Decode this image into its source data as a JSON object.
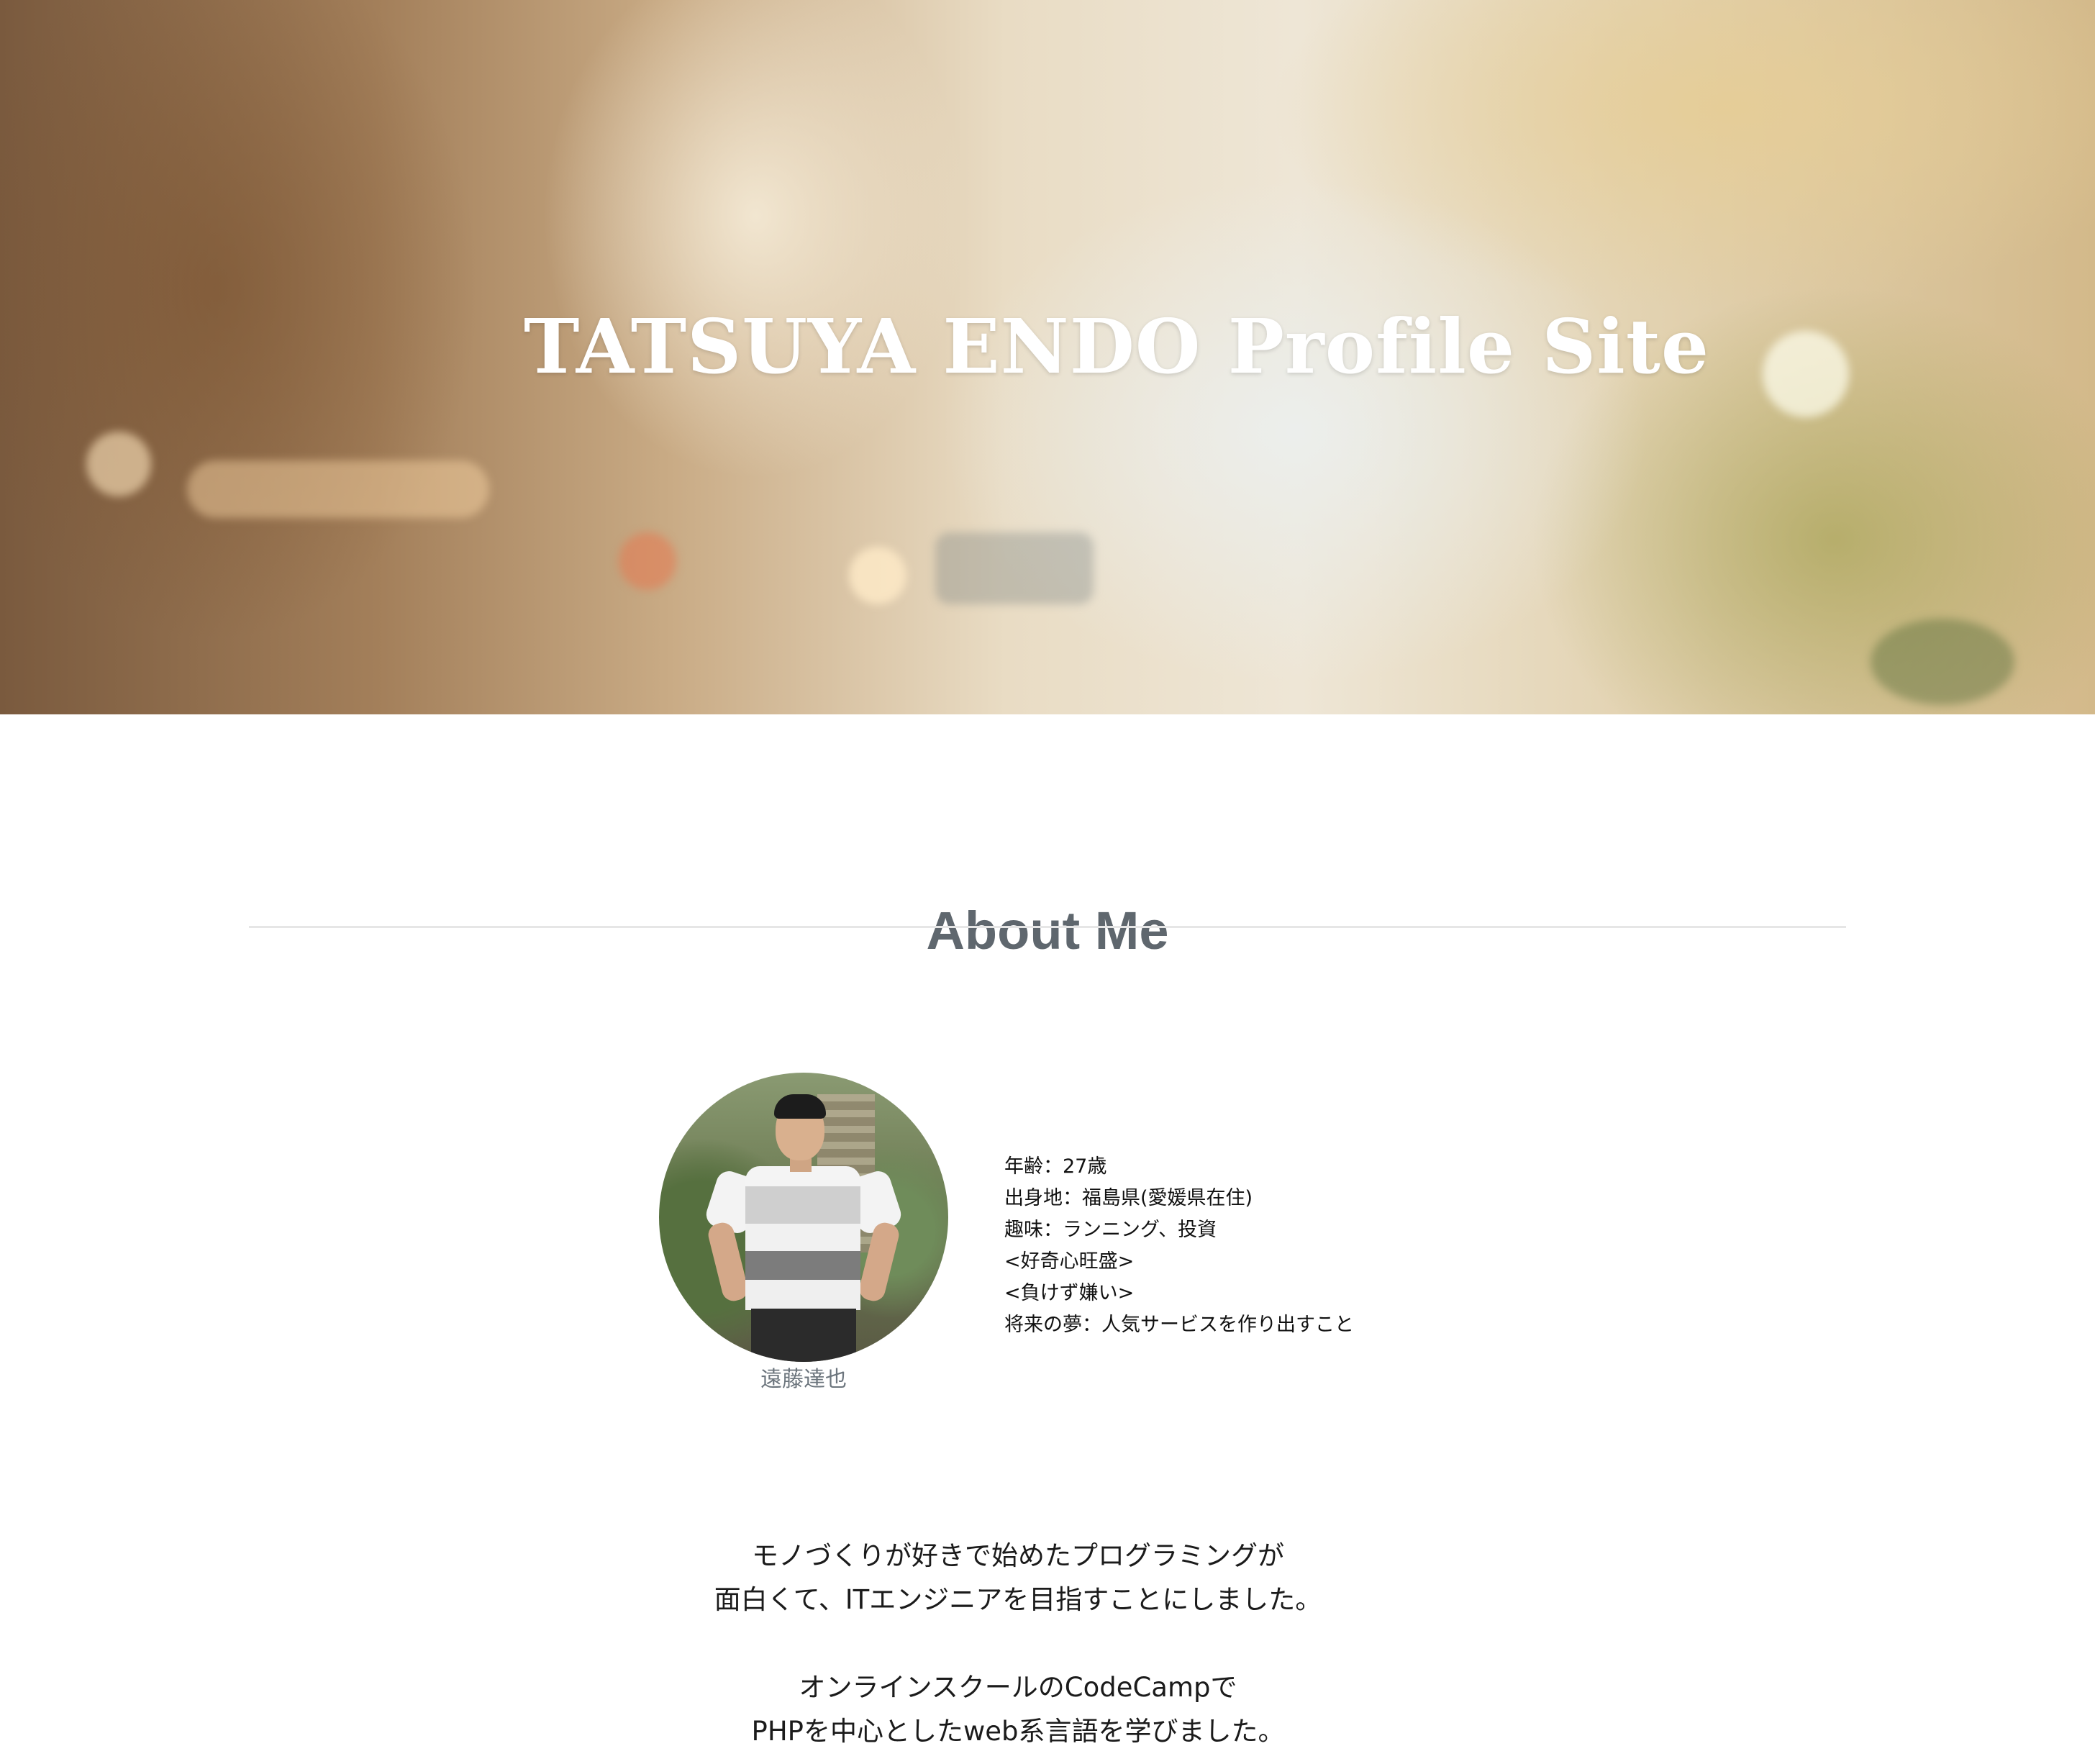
{
  "hero": {
    "title": "TATSUYA ENDO Profile Site"
  },
  "about": {
    "heading": "About Me",
    "name_caption": "遠藤達也",
    "profile": [
      "年齢：27歳",
      "出身地：福島県(愛媛県在住)",
      "趣味：ランニング、投資",
      "<好奇心旺盛>",
      "<負けず嫌い>",
      "将来の夢：人気サービスを作り出すこと"
    ],
    "intro": [
      "モノづくりが好きで始めたプログラミングが",
      "面白くて、ITエンジニアを目指すことにしました。",
      "オンラインスクールのCodeCampで",
      "PHPを中心としたweb系言語を学びました。"
    ]
  },
  "colors": {
    "heading": "#5f676e",
    "caption": "#6c757d",
    "rule": "#e6e6e6"
  }
}
